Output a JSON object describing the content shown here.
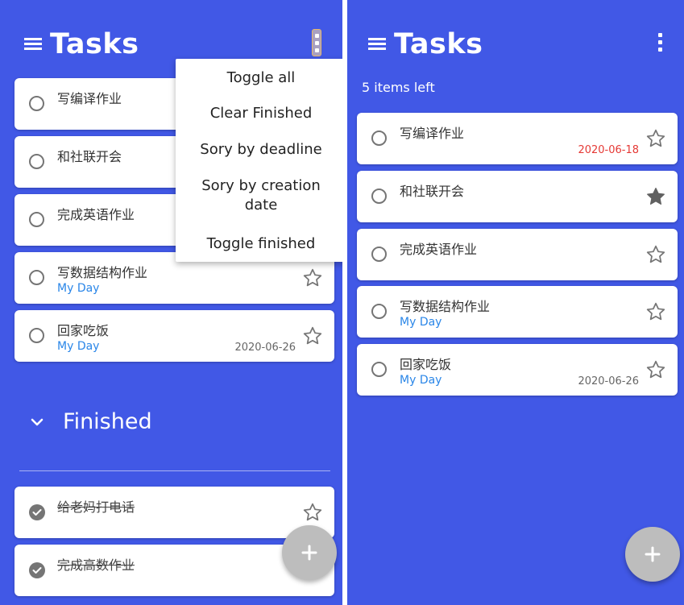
{
  "colors": {
    "background": "#4158e6",
    "card": "#ffffff",
    "accent_blue": "#2a86e8",
    "overdue_red": "#e53935",
    "fab": "#bdbdbd"
  },
  "left": {
    "title": "Tasks",
    "menu": {
      "items": [
        "Toggle all",
        "Clear Finished",
        "Sory by deadline",
        "Sory by creation date",
        "Toggle finished"
      ]
    },
    "tasks": [
      {
        "title": "写编译作业",
        "sub": "",
        "date": "",
        "starred": false
      },
      {
        "title": "和社联开会",
        "sub": "",
        "date": "",
        "starred": true
      },
      {
        "title": "完成英语作业",
        "sub": "",
        "date": "",
        "starred": false
      },
      {
        "title": "写数据结构作业",
        "sub": "My Day",
        "date": "",
        "starred": false
      },
      {
        "title": "回家吃饭",
        "sub": "My Day",
        "date": "2020-06-26",
        "starred": false
      }
    ],
    "finished": {
      "label": "Finished",
      "tasks": [
        {
          "title": "给老妈打电话"
        },
        {
          "title": "完成高数作业"
        }
      ]
    },
    "fab_icon": "plus-icon"
  },
  "right": {
    "title": "Tasks",
    "items_left": "5 items left",
    "tasks": [
      {
        "title": "写编译作业",
        "sub": "",
        "date": "2020-06-18",
        "overdue": true,
        "starred": false
      },
      {
        "title": "和社联开会",
        "sub": "",
        "date": "",
        "starred": true
      },
      {
        "title": "完成英语作业",
        "sub": "",
        "date": "",
        "starred": false
      },
      {
        "title": "写数据结构作业",
        "sub": "My Day",
        "date": "",
        "starred": false
      },
      {
        "title": "回家吃饭",
        "sub": "My Day",
        "date": "2020-06-26",
        "starred": false
      }
    ],
    "fab_icon": "plus-icon"
  }
}
